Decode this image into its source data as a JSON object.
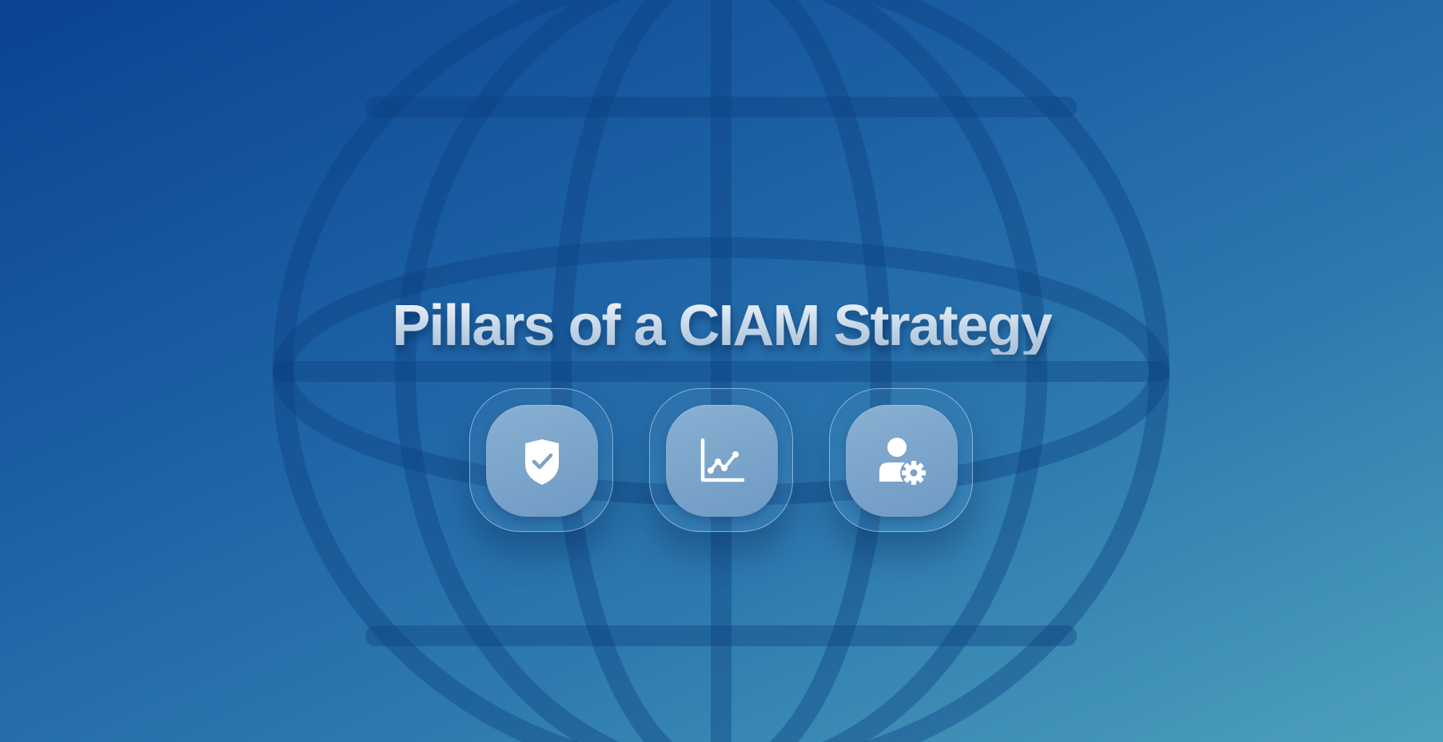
{
  "title": "Pillars of a CIAM Strategy",
  "pillars": [
    {
      "icon": "shield-check-icon"
    },
    {
      "icon": "line-chart-icon"
    },
    {
      "icon": "user-settings-icon"
    }
  ],
  "colors": {
    "background_start": "#0a4391",
    "background_end": "#4da1ba",
    "globe_lines": "#0b3f7f",
    "tile": "#7ba3c9",
    "icon": "#ffffff"
  }
}
